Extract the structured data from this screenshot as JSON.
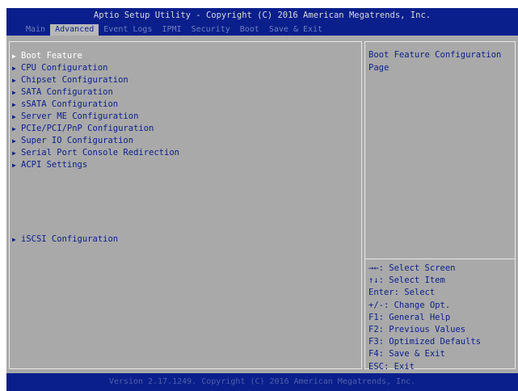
{
  "title": "Aptio Setup Utility - Copyright (C) 2016 American Megatrends, Inc.",
  "tabs": [
    {
      "label": "Main"
    },
    {
      "label": "Advanced"
    },
    {
      "label": "Event Logs"
    },
    {
      "label": "IPMI"
    },
    {
      "label": "Security"
    },
    {
      "label": "Boot"
    },
    {
      "label": "Save & Exit"
    }
  ],
  "active_tab": "Advanced",
  "menu": {
    "items": [
      {
        "label": "Boot Feature"
      },
      {
        "label": "CPU Configuration"
      },
      {
        "label": "Chipset Configuration"
      },
      {
        "label": "SATA Configuration"
      },
      {
        "label": "sSATA Configuration"
      },
      {
        "label": "Server ME Configuration"
      },
      {
        "label": "PCIe/PCI/PnP Configuration"
      },
      {
        "label": "Super IO Configuration"
      },
      {
        "label": "Serial Port Console Redirection"
      },
      {
        "label": "ACPI Settings"
      },
      {
        "label": "iSCSI Configuration"
      }
    ],
    "selected": "Boot Feature"
  },
  "help": {
    "line1": "Boot Feature Configuration",
    "line2": "Page"
  },
  "keys": [
    {
      "text": "→←: Select Screen"
    },
    {
      "text": "↑↓: Select Item"
    },
    {
      "text": "Enter: Select"
    },
    {
      "text": "+/-: Change Opt."
    },
    {
      "text": "F1: General Help"
    },
    {
      "text": "F2: Previous Values"
    },
    {
      "text": "F3: Optimized Defaults"
    },
    {
      "text": "F4: Save & Exit"
    },
    {
      "text": "ESC: Exit"
    }
  ],
  "footer": "Version 2.17.1249. Copyright (C) 2016 American Megatrends, Inc.",
  "colors": {
    "bios_blue": "#0a1f8c",
    "panel_gray": "#a9a9a9",
    "highlight_white": "#ffffff"
  },
  "icons": {
    "submenu_marker": "submenu-arrow-icon"
  }
}
